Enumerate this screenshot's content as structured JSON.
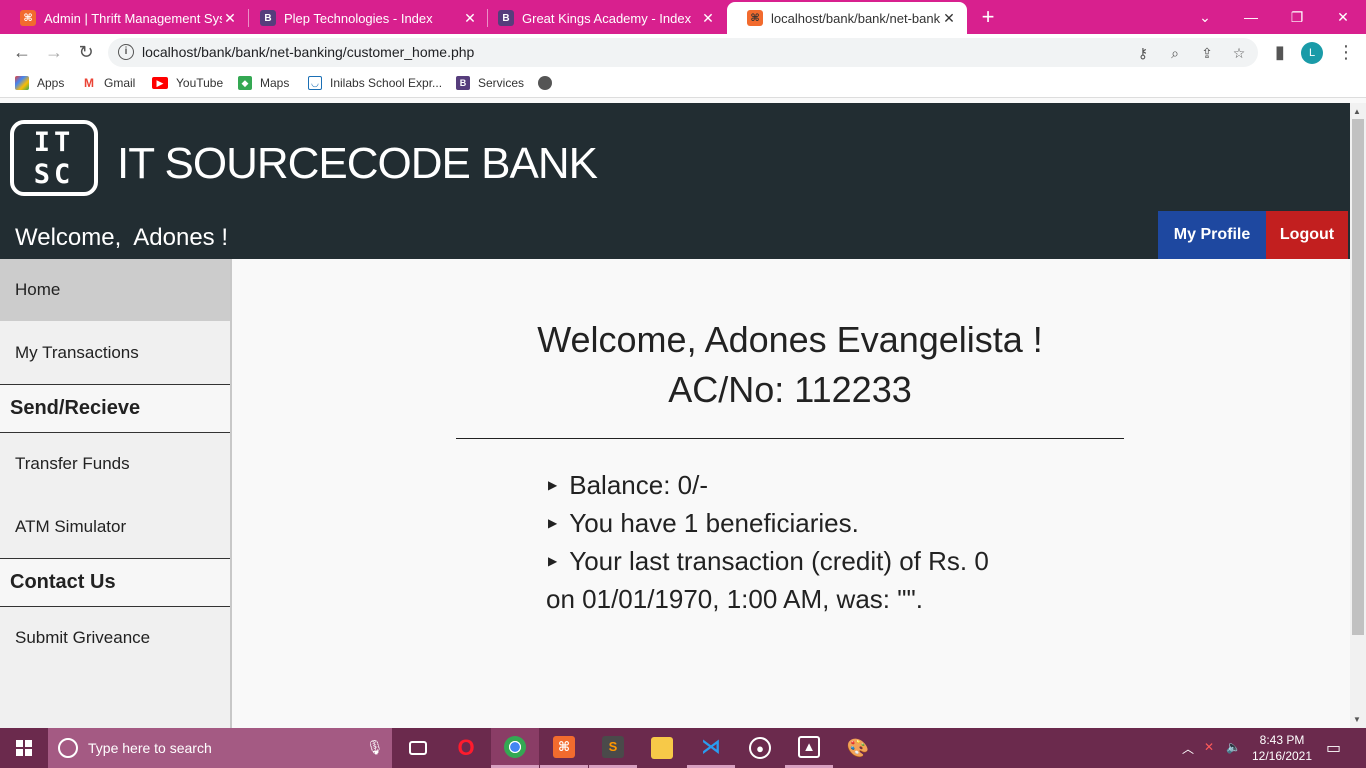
{
  "browser": {
    "tabs": [
      {
        "title": "Admin | Thrift Management Syste",
        "favicon": "xampp-icon"
      },
      {
        "title": "Plep Technologies - Index",
        "favicon": "bootstrap-icon"
      },
      {
        "title": "Great Kings Academy - Index",
        "favicon": "bootstrap-icon"
      },
      {
        "title": "localhost/bank/bank/net-banking",
        "favicon": "xampp-icon"
      }
    ],
    "address": "localhost/bank/bank/net-banking/customer_home.php",
    "profile_initial": "L",
    "bookmarks": [
      {
        "label": "Apps"
      },
      {
        "label": "Gmail"
      },
      {
        "label": "YouTube"
      },
      {
        "label": "Maps"
      },
      {
        "label": "Inilabs School Expr..."
      },
      {
        "label": "Services"
      }
    ]
  },
  "header": {
    "logo_text_top": "IT",
    "logo_text_bottom": "SC",
    "brand": "IT SOURCECODE BANK",
    "welcome": "Welcome,  Adones !",
    "profile_button": "My Profile",
    "logout_button": "Logout",
    "colors": {
      "header_bg": "#222d32",
      "profile_btn": "#1e48a0",
      "logout_btn": "#c21f1f"
    }
  },
  "sidebar": {
    "home": "Home",
    "transactions": "My Transactions",
    "send_receive_heading": "Send/Recieve",
    "transfer_funds": "Transfer Funds",
    "atm_simulator": "ATM Simulator",
    "contact_heading": "Contact Us",
    "submit_grievance": "Submit Griveance"
  },
  "main": {
    "greeting": "Welcome, Adones Evangelista !",
    "account": "AC/No: 112233",
    "balance": "Balance: 0/-",
    "beneficiaries": "You have 1 beneficiaries.",
    "last_txn_line1": "Your last transaction (credit) of Rs. 0",
    "last_txn_line2": "on 01/01/1970, 1:00 AM, was: \"\"."
  },
  "taskbar": {
    "search_placeholder": "Type here to search",
    "time": "8:43 PM",
    "date": "12/16/2021"
  }
}
